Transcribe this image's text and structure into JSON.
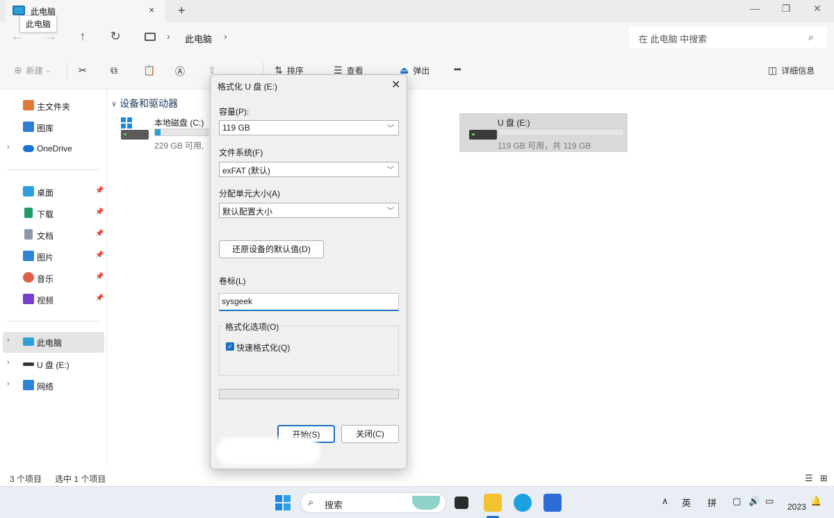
{
  "window": {
    "tab_title": "此电脑",
    "tab_close": "×",
    "new_tab": "+",
    "tooltip": "此电脑",
    "minimize": "—",
    "maximize": "❐",
    "close": "✕"
  },
  "nav": {
    "back": "←",
    "forward": "→",
    "up": "↑",
    "refresh": "↻",
    "breadcrumb": "此电脑",
    "chevron": "›",
    "search_placeholder": "在 此电脑 中搜索",
    "search_icon": "⌕"
  },
  "toolbar": {
    "new": "新建",
    "new_icon": "⊕",
    "cut_icon": "✂",
    "copy_icon": "⧉",
    "paste_icon": "📋",
    "rename_icon": "Ⓐ",
    "share_icon": "⇪",
    "delete_icon": "🗑",
    "sort": "排序",
    "view": "查看",
    "eject": "弹出",
    "eject_icon": "⏏",
    "more": "•••",
    "details": "详细信息",
    "details_icon": "◫"
  },
  "sidebar": {
    "quick": [
      {
        "label": "主文件夹",
        "icon": "home-icon",
        "color": "#e07a3a"
      },
      {
        "label": "图库",
        "icon": "gallery-icon",
        "color": "#2f7fd0"
      },
      {
        "label": "OneDrive",
        "icon": "onedrive-icon",
        "color": "#1a73d6"
      }
    ],
    "pinned": [
      {
        "label": "桌面",
        "icon": "desktop-icon",
        "color": "#2aa0e0"
      },
      {
        "label": "下载",
        "icon": "download-icon",
        "color": "#1f9c6a"
      },
      {
        "label": "文档",
        "icon": "documents-icon",
        "color": "#8a98a8"
      },
      {
        "label": "图片",
        "icon": "pictures-icon",
        "color": "#2f84d8"
      },
      {
        "label": "音乐",
        "icon": "music-icon",
        "color": "#e0614a"
      },
      {
        "label": "视频",
        "icon": "videos-icon",
        "color": "#7b3fd0"
      }
    ],
    "pin_glyph": "📌",
    "devices": [
      {
        "label": "此电脑",
        "icon": "this-pc-icon",
        "color": "#2f9fd8"
      },
      {
        "label": "U 盘 (E:)",
        "icon": "usb-drive-icon",
        "color": "#333333"
      },
      {
        "label": "网络",
        "icon": "network-icon",
        "color": "#2f84d8"
      }
    ],
    "expand_glyph": "›"
  },
  "content": {
    "group_title": "设备和驱动器",
    "group_chevron": "∨",
    "drive_c": {
      "name": "本地磁盘 (C:)",
      "free": "229 GB 可用,",
      "used_fraction": 0.1
    },
    "drive_e": {
      "name": "U 盘 (E:)",
      "free": "119 GB 可用，共 119 GB",
      "used_fraction": 0.0
    }
  },
  "status": {
    "count": "3 个项目",
    "selected": "选中 1 个项目"
  },
  "dialog": {
    "title": "格式化 U 盘 (E:)",
    "close": "✕",
    "capacity_label": "容量(P):",
    "capacity_value": "119 GB",
    "filesystem_label": "文件系统(F)",
    "filesystem_value": "exFAT (默认)",
    "alloc_label": "分配单元大小(A)",
    "alloc_value": "默认配置大小",
    "restore_button": "还原设备的默认值(D)",
    "volume_label": "卷标(L)",
    "volume_value": "sysgeek",
    "options_legend": "格式化选项(O)",
    "quick_format": "快速格式化(Q)",
    "quick_format_checked": true,
    "start_button": "开始(S)",
    "close_button": "关闭(C)",
    "progress": 0,
    "arrow": "﹀"
  },
  "taskbar": {
    "search_placeholder": "搜索",
    "search_icon": "⌕",
    "ime_lang": "英",
    "ime_mode": "拼",
    "year": "2023",
    "tray_up": "∧",
    "bell": "🔔",
    "volume_icon": "🔊"
  },
  "colors": {
    "accent": "#1a6fc4",
    "drive_fill": "#26a0da"
  }
}
